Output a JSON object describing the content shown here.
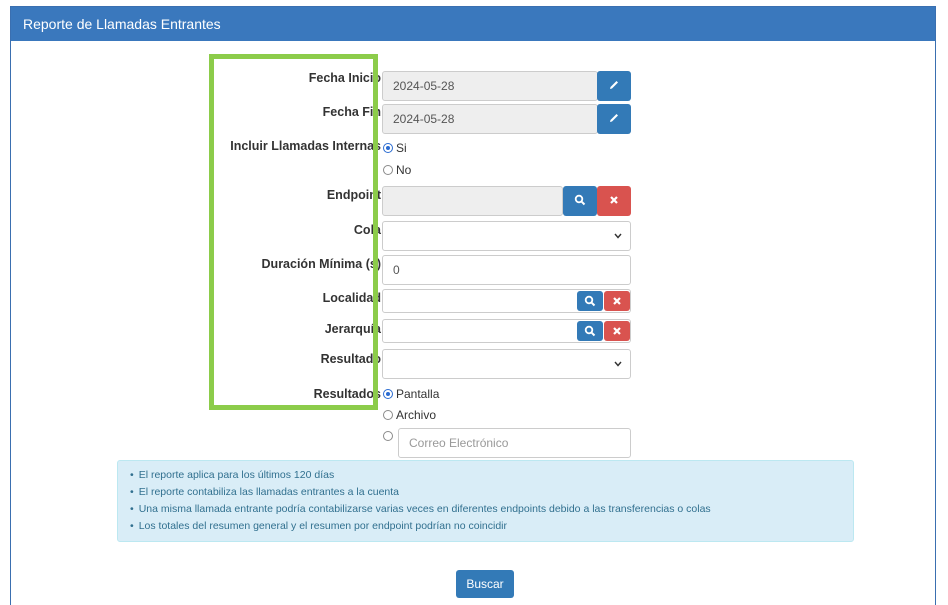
{
  "header": {
    "title": "Reporte de Llamadas Entrantes"
  },
  "form": {
    "fecha_inicio": {
      "label": "Fecha Inicio",
      "value": "2024-05-28"
    },
    "fecha_fin": {
      "label": "Fecha Fin",
      "value": "2024-05-28"
    },
    "incluir_internas": {
      "label": "Incluir Llamadas Internas",
      "options": [
        "Si",
        "No"
      ],
      "selected": "Si"
    },
    "endpoint": {
      "label": "Endpoint",
      "value": ""
    },
    "cola": {
      "label": "Cola",
      "value": ""
    },
    "duracion_minima": {
      "label": "Duración Mínima (s)",
      "value": "0"
    },
    "localidad": {
      "label": "Localidad",
      "value": ""
    },
    "jerarquia": {
      "label": "Jerarquía",
      "value": ""
    },
    "resultado": {
      "label": "Resultado",
      "value": ""
    },
    "resultados": {
      "label": "Resultados",
      "options": [
        "Pantalla",
        "Archivo"
      ],
      "selected": "Pantalla",
      "email_placeholder": "Correo Electrónico"
    }
  },
  "info": {
    "items": [
      "El reporte aplica para los últimos 120 días",
      "El reporte contabiliza las llamadas entrantes a la cuenta",
      "Una misma llamada entrante podría contabilizarse varias veces en diferentes endpoints debido a las transferencias o colas",
      "Los totales del resumen general y el resumen por endpoint podrían no coincidir"
    ]
  },
  "buttons": {
    "search_label": "Buscar"
  },
  "colors": {
    "header": "#3a78bd",
    "primary": "#337ab7",
    "danger": "#d9534f",
    "highlight": "#8ccc4a",
    "info_bg": "#d9edf7"
  },
  "icons": {
    "edit": "pencil-icon",
    "search": "search-icon",
    "clear": "close-icon",
    "dropdown": "chevron-down-icon"
  }
}
